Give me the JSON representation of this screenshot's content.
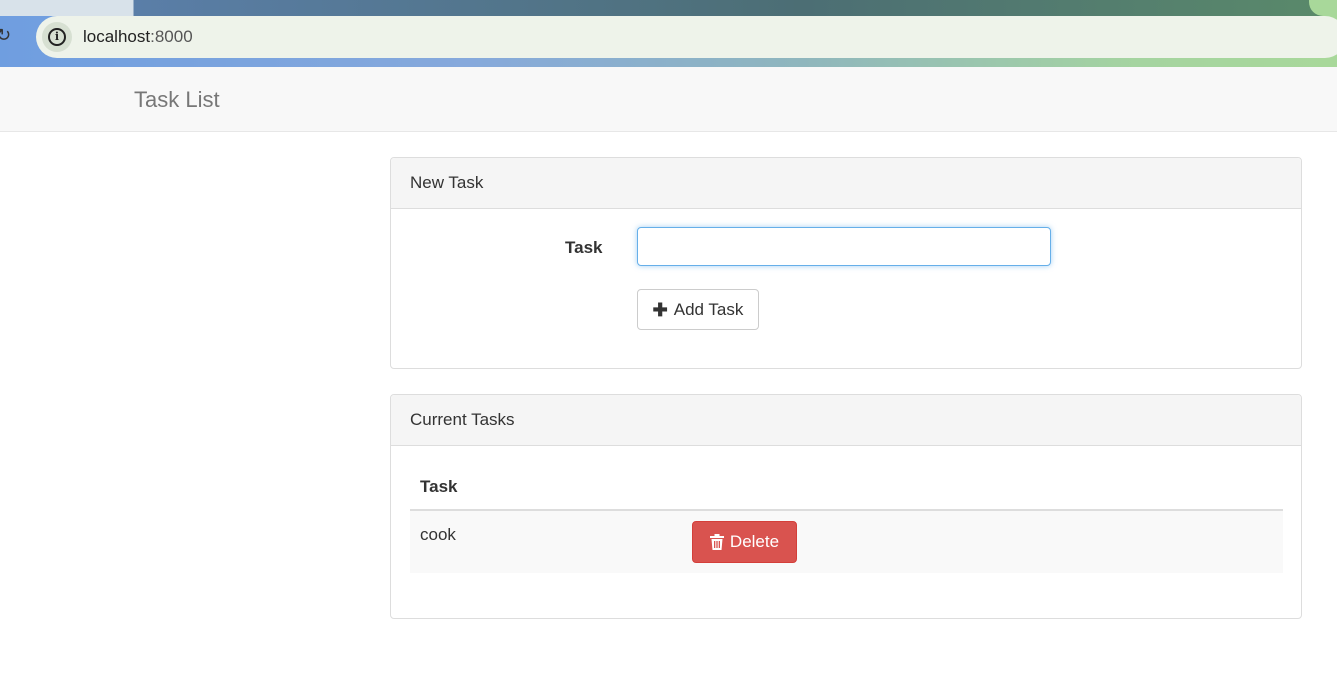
{
  "browser": {
    "url_host": "localhost",
    "url_port": ":8000"
  },
  "navbar": {
    "brand": "Task List"
  },
  "new_task_panel": {
    "heading": "New Task",
    "task_label": "Task",
    "task_input_value": "",
    "add_button_label": "Add Task"
  },
  "current_tasks_panel": {
    "heading": "Current Tasks",
    "column_header": "Task",
    "rows": [
      {
        "task": "cook",
        "delete_label": "Delete"
      }
    ]
  },
  "colors": {
    "danger": "#d9534f",
    "focus_border": "#66afe9",
    "navbar_bg": "#f8f8f8",
    "panel_heading_bg": "#f5f5f5"
  },
  "icons": {
    "reload": "reload-icon",
    "site_info": "info-icon",
    "add": "plus-icon",
    "delete": "trash-icon"
  }
}
